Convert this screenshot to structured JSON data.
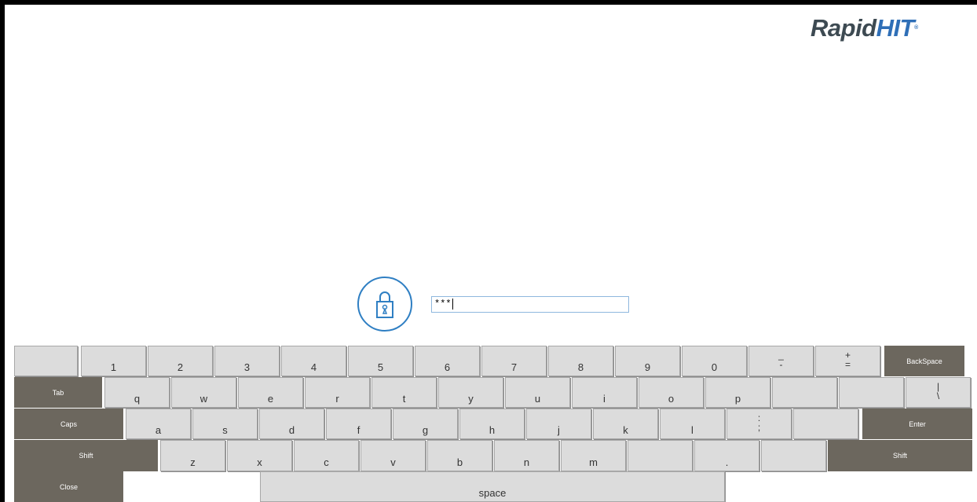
{
  "logo": {
    "part1": "Rapid",
    "part2": "HIT",
    "reg": "®"
  },
  "password": {
    "value": "***"
  },
  "icons": {
    "lock": "lock-icon"
  },
  "colors": {
    "accent": "#2f7fc3",
    "key_face": "#dcdcdc",
    "key_dark": "#6c675e"
  },
  "keyboard": {
    "row1": [
      "",
      "1",
      "2",
      "3",
      "4",
      "5",
      "6",
      "7",
      "8",
      "9",
      "0",
      "_\n-",
      "+\n=",
      "BackSpace"
    ],
    "row2": [
      "Tab",
      "q",
      "w",
      "e",
      "r",
      "t",
      "y",
      "u",
      "i",
      "o",
      "p",
      "",
      "",
      "|\n\\"
    ],
    "row3": [
      "Caps",
      "a",
      "s",
      "d",
      "f",
      "g",
      "h",
      "j",
      "k",
      "l",
      ":\n;",
      "",
      "Enter"
    ],
    "row4": [
      "Shift",
      "z",
      "x",
      "c",
      "v",
      "b",
      "n",
      "m",
      "",
      ".",
      "",
      "Shift"
    ],
    "row5": [
      "Close",
      "space"
    ]
  }
}
